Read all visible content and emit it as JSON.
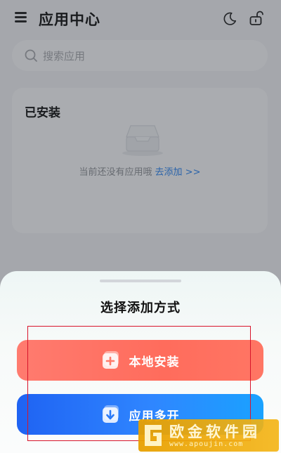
{
  "header": {
    "title": "应用中心",
    "icons": [
      "menu-icon",
      "moon-icon",
      "unlock-icon"
    ]
  },
  "search": {
    "placeholder": "搜索应用",
    "icon": "search-icon"
  },
  "installed": {
    "title": "已安装",
    "empty_text": "当前还没有应用哦",
    "add_link": "去添加 >>",
    "icon": "empty-tray-icon"
  },
  "sheet": {
    "title": "选择添加方式",
    "options": [
      {
        "label": "本地安装",
        "icon": "plus-icon",
        "color": "#ff6f60"
      },
      {
        "label": "应用多开",
        "icon": "download-icon",
        "color": "#2a74ff"
      }
    ]
  },
  "watermark": {
    "text": "欧金软件园",
    "url": "www.apoujin.com"
  },
  "colors": {
    "accent_link": "#2a84f0",
    "highlight": "#d8152b"
  }
}
